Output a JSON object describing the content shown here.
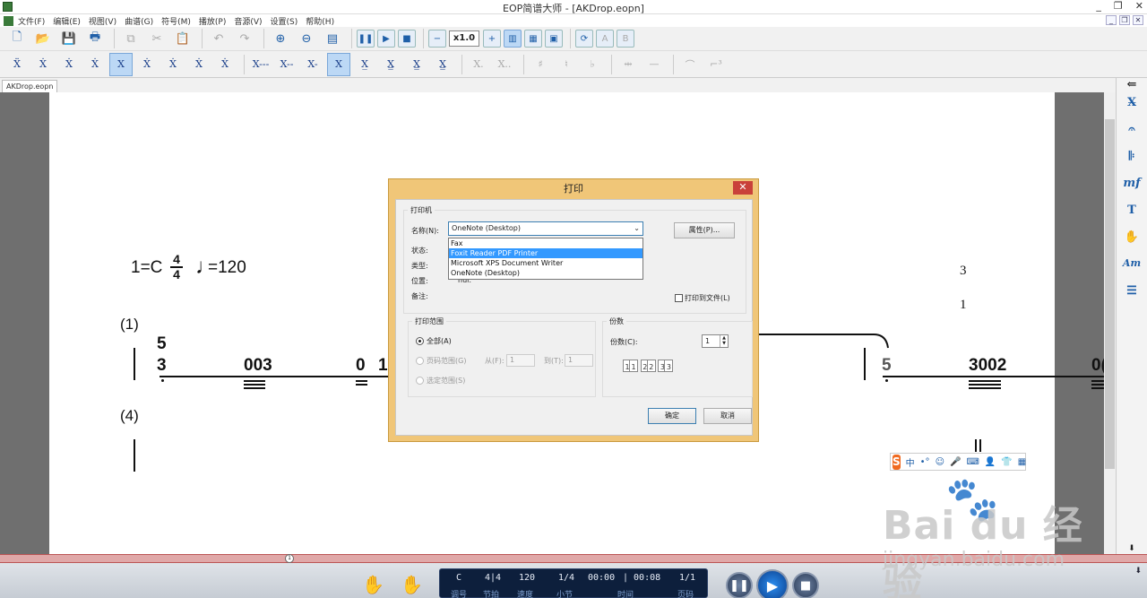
{
  "window": {
    "title": "EOP简谱大师 - [AKDrop.eopn]",
    "controls": [
      "_",
      "❐",
      "✕"
    ]
  },
  "menu": [
    "文件(F)",
    "编辑(E)",
    "视图(V)",
    "曲谱(G)",
    "符号(M)",
    "播放(P)",
    "音源(V)",
    "设置(S)",
    "帮助(H)"
  ],
  "toolbar": {
    "zoom": "x1.0"
  },
  "tab": {
    "filename": "AKDrop.eopn"
  },
  "score": {
    "key_sig": "1=C",
    "time_top": "4",
    "time_bottom": "4",
    "tempo": "=120",
    "measure_1": "(1)",
    "measure_4": "(4)",
    "note_5": "5",
    "note_3": "3",
    "note_003": "003",
    "note_0": "0",
    "note_1": "1",
    "note_r5": "5",
    "note_3002": "3002",
    "note_0cut": "0(",
    "num_3": "3",
    "num_1": "1"
  },
  "dialog": {
    "title": "打印",
    "close": "✕",
    "printer_group": "打印机",
    "name_label": "名称(N):",
    "printer_selected": "OneNote (Desktop)",
    "properties_button": "属性(P)...",
    "status_label": "状态:",
    "type_label": "类型:",
    "location_label": "位置:",
    "location_value": "nul:",
    "comment_label": "备注:",
    "print_to_file": "打印到文件(L)",
    "printer_options": [
      "Fax",
      "Foxit Reader PDF Printer",
      "Microsoft XPS Document Writer",
      "OneNote (Desktop)"
    ],
    "highlighted_option": "Foxit Reader PDF Printer",
    "range_group": "打印范围",
    "range_all": "全部(A)",
    "range_pages": "页码范围(G)",
    "from_label": "从(F):",
    "from_value": "1",
    "to_label": "到(T):",
    "to_value": "1",
    "range_selection": "选定范围(S)",
    "copies_group": "份数",
    "copies_label": "份数(C):",
    "copies_value": "1",
    "ok": "确定",
    "cancel": "取消"
  },
  "playback": {
    "values": [
      "C",
      "4|4",
      "120",
      "1/4",
      "00:00",
      "| 00:08",
      "1/1"
    ],
    "labels": [
      "调号",
      "节拍",
      "速度",
      "小节",
      "时间",
      "页码"
    ]
  },
  "timeline": {
    "marker": "1"
  },
  "ime": {
    "items": [
      "中",
      "•°",
      "☺",
      "🎤",
      "⌨",
      "👤",
      "👕",
      "▦"
    ]
  },
  "watermark": {
    "brand": "Bai du 经验",
    "url": "jingyan.baidu.com"
  }
}
